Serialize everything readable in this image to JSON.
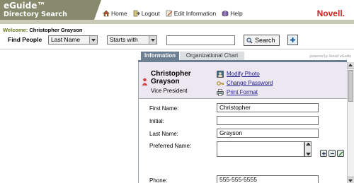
{
  "app": {
    "title": "eGuide™",
    "subtitle": "Directory Search",
    "brand": "Novell."
  },
  "toplinks": [
    {
      "label": "Home",
      "icon": "home-icon"
    },
    {
      "label": "Logout",
      "icon": "logout-icon"
    },
    {
      "label": "Edit Information",
      "icon": "edit-icon"
    },
    {
      "label": "Help",
      "icon": "help-icon"
    }
  ],
  "welcome": {
    "prefix": "Welcome:",
    "user": "Christopher Grayson"
  },
  "find": {
    "label": "Find People",
    "attribute_selected": "Last Name",
    "operator_selected": "Starts with",
    "query_value": "",
    "search_label": "Search"
  },
  "tabs": [
    {
      "label": "Information",
      "active": true
    },
    {
      "label": "Organizational Chart",
      "active": false
    }
  ],
  "powered_by": "powered by Novell eGuide",
  "profile": {
    "first": "Christopher",
    "last": "Grayson",
    "title": "Vice President",
    "actions": [
      {
        "label": "Modify Photo",
        "icon": "photo-icon"
      },
      {
        "label": "Change Password",
        "icon": "key-icon"
      },
      {
        "label": "Print Format",
        "icon": "printer-icon"
      }
    ]
  },
  "form": {
    "first_name": {
      "label": "First Name:",
      "value": "Christopher"
    },
    "initial": {
      "label": "Initial:",
      "value": ""
    },
    "last_name": {
      "label": "Last Name:",
      "value": "Grayson"
    },
    "preferred_name": {
      "label": "Preferred Name:",
      "value": ""
    },
    "phone": {
      "label": "Phone:",
      "value": "555-555-5555"
    }
  },
  "colors": {
    "brand_olive": "#878a6c",
    "novell_red": "#cc1f1f",
    "tab_active": "#6d7f92",
    "profile_bg": "#ede7f1",
    "link_blue": "#1a1a8c"
  }
}
